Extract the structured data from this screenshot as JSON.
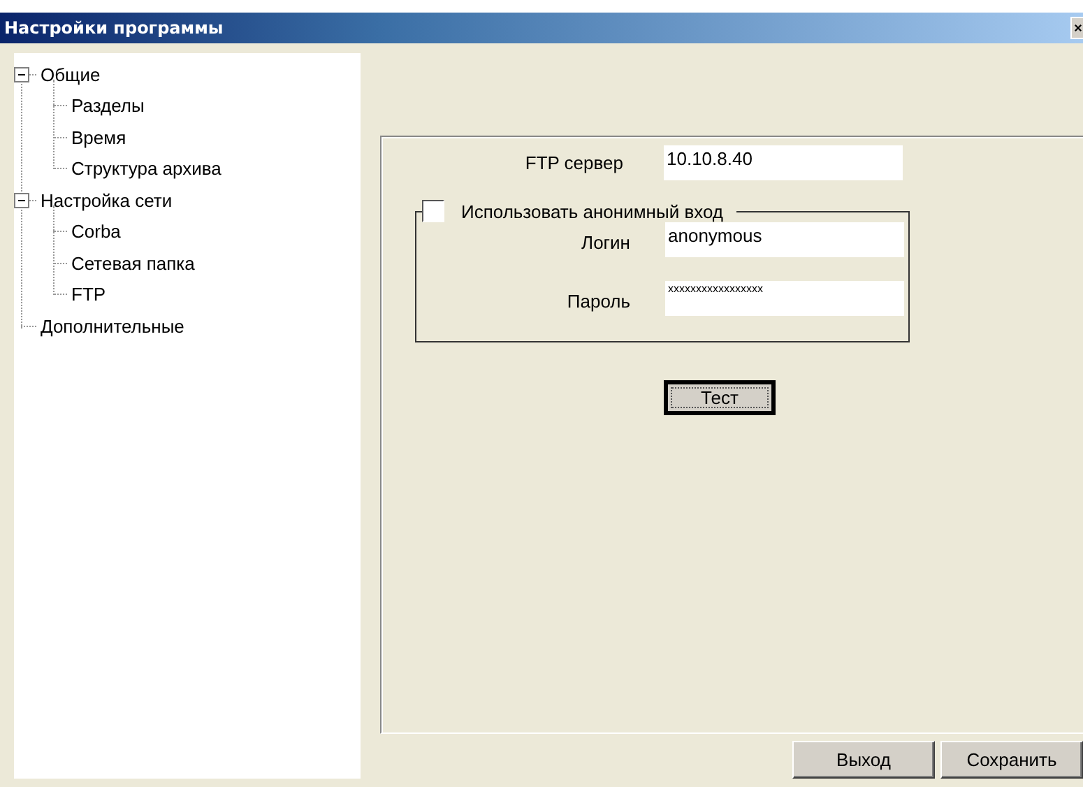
{
  "window": {
    "title": "Настройки программы"
  },
  "tree": [
    {
      "label": "Общие",
      "expanded": true,
      "children": [
        {
          "label": "Разделы"
        },
        {
          "label": "Время"
        },
        {
          "label": "Структура архива"
        }
      ]
    },
    {
      "label": "Настройка сети",
      "expanded": true,
      "children": [
        {
          "label": "Corba"
        },
        {
          "label": "Сетевая папка"
        },
        {
          "label": "FTP"
        }
      ]
    },
    {
      "label": "Дополнительные"
    }
  ],
  "ftp_server": {
    "label": "FTP сервер",
    "value": "10.10.8.40"
  },
  "anonymous_group": {
    "label": "Использовать анонимный вход",
    "checked": false,
    "fields": [
      {
        "label": "Логин",
        "value": "anonymous"
      },
      {
        "label": "Пароль",
        "value": "xxxxxxxxxxxxxxxxx"
      }
    ]
  },
  "test_button": "Тест",
  "buttons": [
    "Выход",
    "Сохранить"
  ]
}
